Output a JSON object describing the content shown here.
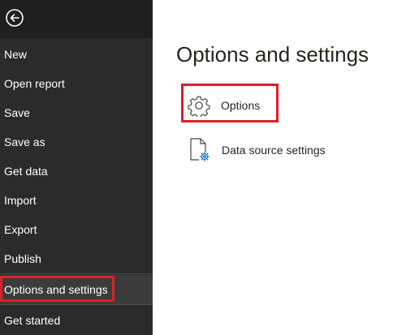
{
  "sidebar": {
    "back_icon": "back-arrow-circle-icon",
    "items": [
      {
        "label": "New"
      },
      {
        "label": "Open report"
      },
      {
        "label": "Save"
      },
      {
        "label": "Save as"
      },
      {
        "label": "Get data"
      },
      {
        "label": "Import"
      },
      {
        "label": "Export"
      },
      {
        "label": "Publish"
      },
      {
        "label": "Options and settings",
        "selected": true
      },
      {
        "label": "Get started"
      }
    ]
  },
  "main": {
    "title": "Options and settings",
    "options": [
      {
        "label": "Options",
        "icon": "gear-icon"
      },
      {
        "label": "Data source settings",
        "icon": "document-gear-icon"
      }
    ]
  },
  "colors": {
    "sidebar_bg": "#2b2b2b",
    "back_bar_bg": "#1f1f1f",
    "highlight": "#d9222a",
    "icon_accent": "#1f77c4"
  }
}
